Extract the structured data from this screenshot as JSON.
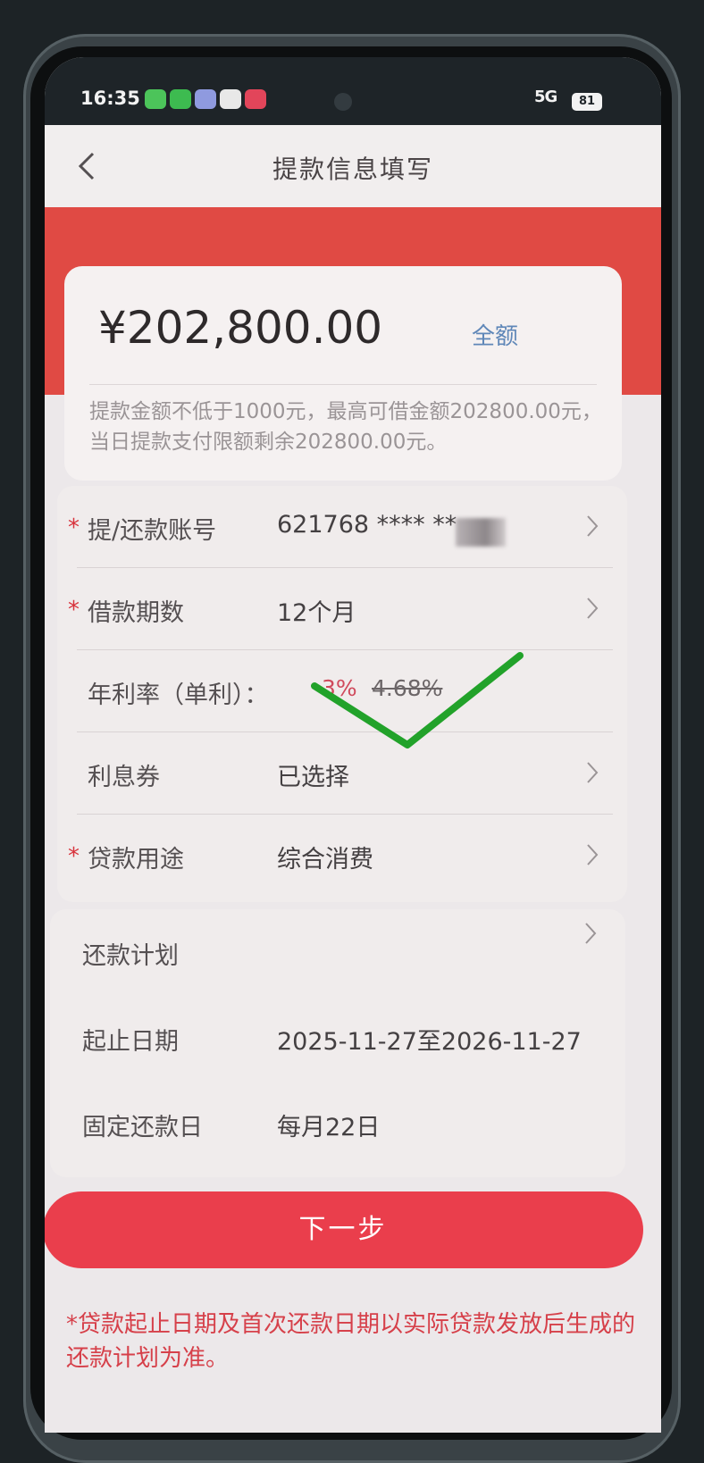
{
  "status_bar": {
    "time": "16:35",
    "battery": "81",
    "signal": "5G"
  },
  "header": {
    "title": "提款信息填写"
  },
  "amount_card": {
    "amount": "¥202,800.00",
    "full_amount_label": "全额",
    "hint": "提款金额不低于1000元，最高可借金额202800.00元，当日提款支付限额剩余202800.00元。"
  },
  "form": {
    "account": {
      "star": "*",
      "label": "提/还款账号",
      "value": "621768 **** **"
    },
    "term": {
      "star": "*",
      "label": "借款期数",
      "value": "12个月"
    },
    "rate": {
      "label": "年利率（单利）：",
      "new_rate": "3%",
      "old_rate": "4.68%"
    },
    "coupon": {
      "label": "利息券",
      "value": "已选择"
    },
    "purpose": {
      "star": "*",
      "label": "贷款用途",
      "value": "综合消费"
    }
  },
  "plan": {
    "title": "还款计划",
    "date_range_label": "起止日期",
    "date_range_value": "2025-11-27至2026-11-27",
    "fixed_day_label": "固定还款日",
    "fixed_day_value": "每月22日"
  },
  "next_button": {
    "label": "下一步"
  },
  "disclaimer": "*贷款起止日期及首次还款日期以实际贷款发放后生成的还款计划为准。",
  "colors": {
    "accent_red": "#e04a44",
    "button_red": "#ea3e4c",
    "link_blue": "#5f87b8",
    "annotation_green": "#22a22a"
  },
  "icons": [
    "back-icon",
    "chevron-right-icon",
    "checkmark-annotation-icon"
  ]
}
